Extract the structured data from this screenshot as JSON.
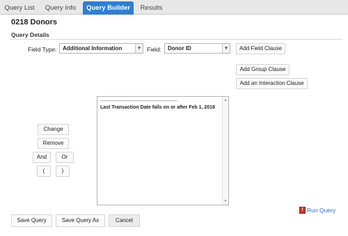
{
  "tabs": [
    {
      "label": "Query List"
    },
    {
      "label": "Query Info"
    },
    {
      "label": "Query Builder"
    },
    {
      "label": "Results"
    }
  ],
  "active_tab": "Query Builder",
  "page_title": "0218 Donors",
  "section_title": "Query Details",
  "field_type": {
    "label": "Field Type:",
    "value": "Additional Information"
  },
  "field": {
    "label": "Field:",
    "value": "Donor ID"
  },
  "buttons": {
    "add_field_clause": "Add Field Clause",
    "add_group_clause": "Add Group Clause",
    "add_interaction_clause": "Add an Interaction Clause",
    "change": "Change",
    "remove": "Remove",
    "and": "And",
    "or": "Or",
    "open_paren": "(",
    "close_paren": ")",
    "save_query": "Save Query",
    "save_query_as": "Save Query As",
    "cancel": "Cancel"
  },
  "query": {
    "separator": "------------------------------------------------------------",
    "clause": "Last Transaction Date falls on or after Feb 1, 2018"
  },
  "run_query": "Run Query",
  "icons": {
    "dropdown": "chevron-down-icon",
    "run": "exclamation-icon"
  },
  "colors": {
    "active_tab": "#2f7fcf",
    "link": "#2f6fb8",
    "run_icon": "#c0392b"
  }
}
